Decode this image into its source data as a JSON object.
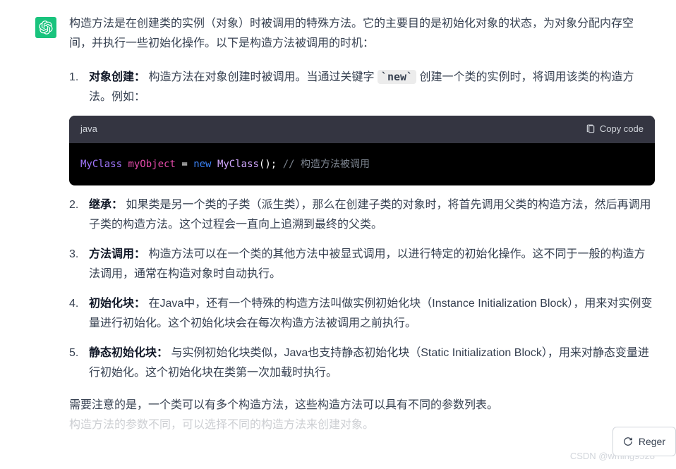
{
  "intro": "构造方法是在创建类的实例（对象）时被调用的特殊方法。它的主要目的是初始化对象的状态，为对象分配内存空间，并执行一些初始化操作。以下是构造方法被调用的时机：",
  "items": [
    {
      "title": "对象创建：",
      "pre": " 构造方法在对象创建时被调用。当通过关键字 ",
      "code": "`new`",
      "post": " 创建一个类的实例时，将调用该类的构造方法。例如："
    },
    {
      "title": "继承：",
      "body": " 如果类是另一个类的子类（派生类），那么在创建子类的对象时，将首先调用父类的构造方法，然后再调用子类的构造方法。这个过程会一直向上追溯到最终的父类。"
    },
    {
      "title": "方法调用：",
      "body": " 构造方法可以在一个类的其他方法中被显式调用，以进行特定的初始化操作。这不同于一般的构造方法调用，通常在构造对象时自动执行。"
    },
    {
      "title": "初始化块：",
      "body": " 在Java中，还有一个特殊的构造方法叫做实例初始化块（Instance Initialization Block），用来对实例变量进行初始化。这个初始化块会在每次构造方法被调用之前执行。"
    },
    {
      "title": "静态初始化块：",
      "body": " 与实例初始化块类似，Java也支持静态初始化块（Static Initialization Block），用来对静态变量进行初始化。这个初始化块在类第一次加载时执行。"
    }
  ],
  "codeblock": {
    "lang": "java",
    "copy_label": "Copy code",
    "tokens": {
      "type": "MyClass",
      "name": "myObject",
      "op": "=",
      "kw": "new",
      "call": "MyClass",
      "punc": "();",
      "comment": "// 构造方法被调用"
    }
  },
  "outro": "需要注意的是，一个类可以有多个构造方法，这些构造方法可以具有不同的参数列表。",
  "outro2": "构造方法的参数不同，可以选择不同的构造方法来创建对象。",
  "regen_label": "Reger",
  "watermark": "CSDN @wming9528"
}
